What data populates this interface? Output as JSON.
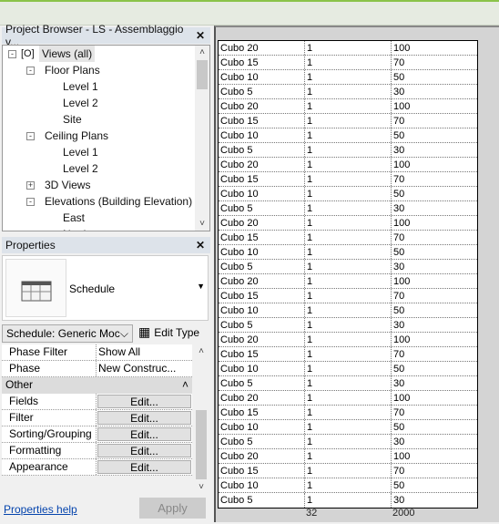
{
  "project_browser": {
    "title": "Project Browser - LS - Assemblaggio v...",
    "items": [
      {
        "label": "Views (all)",
        "level": 0,
        "toggle": "-"
      },
      {
        "label": "Floor Plans",
        "level": 1,
        "toggle": "-"
      },
      {
        "label": "Level 1",
        "level": 2
      },
      {
        "label": "Level 2",
        "level": 2
      },
      {
        "label": "Site",
        "level": 2
      },
      {
        "label": "Ceiling Plans",
        "level": 1,
        "toggle": "-"
      },
      {
        "label": "Level 1",
        "level": 2
      },
      {
        "label": "Level 2",
        "level": 2
      },
      {
        "label": "3D Views",
        "level": 1,
        "toggle": "+"
      },
      {
        "label": "Elevations (Building Elevation)",
        "level": 1,
        "toggle": "-"
      },
      {
        "label": "East",
        "level": 2
      },
      {
        "label": "North",
        "level": 2
      }
    ]
  },
  "properties": {
    "title": "Properties",
    "type_name": "Schedule",
    "selector": "Schedule: Generic Moc",
    "edit_type": "Edit Type",
    "rows": [
      {
        "key": "Phase Filter",
        "value": "Show All"
      },
      {
        "key": "Phase",
        "value": "New Construc..."
      }
    ],
    "group": "Other",
    "buttons": [
      {
        "key": "Fields",
        "value": "Edit..."
      },
      {
        "key": "Filter",
        "value": "Edit..."
      },
      {
        "key": "Sorting/Grouping",
        "value": "Edit..."
      },
      {
        "key": "Formatting",
        "value": "Edit..."
      },
      {
        "key": "Appearance",
        "value": "Edit..."
      }
    ],
    "help": "Properties help",
    "apply": "Apply"
  },
  "schedule": {
    "rows": [
      [
        "Cubo 20",
        "1",
        "100"
      ],
      [
        "Cubo 15",
        "1",
        "70"
      ],
      [
        "Cubo 10",
        "1",
        "50"
      ],
      [
        "Cubo 5",
        "1",
        "30"
      ],
      [
        "Cubo 20",
        "1",
        "100"
      ],
      [
        "Cubo 15",
        "1",
        "70"
      ],
      [
        "Cubo 10",
        "1",
        "50"
      ],
      [
        "Cubo 5",
        "1",
        "30"
      ],
      [
        "Cubo 20",
        "1",
        "100"
      ],
      [
        "Cubo 15",
        "1",
        "70"
      ],
      [
        "Cubo 10",
        "1",
        "50"
      ],
      [
        "Cubo 5",
        "1",
        "30"
      ],
      [
        "Cubo 20",
        "1",
        "100"
      ],
      [
        "Cubo 15",
        "1",
        "70"
      ],
      [
        "Cubo 10",
        "1",
        "50"
      ],
      [
        "Cubo 5",
        "1",
        "30"
      ],
      [
        "Cubo 20",
        "1",
        "100"
      ],
      [
        "Cubo 15",
        "1",
        "70"
      ],
      [
        "Cubo 10",
        "1",
        "50"
      ],
      [
        "Cubo 5",
        "1",
        "30"
      ],
      [
        "Cubo 20",
        "1",
        "100"
      ],
      [
        "Cubo 15",
        "1",
        "70"
      ],
      [
        "Cubo 10",
        "1",
        "50"
      ],
      [
        "Cubo 5",
        "1",
        "30"
      ],
      [
        "Cubo 20",
        "1",
        "100"
      ],
      [
        "Cubo 15",
        "1",
        "70"
      ],
      [
        "Cubo 10",
        "1",
        "50"
      ],
      [
        "Cubo 5",
        "1",
        "30"
      ],
      [
        "Cubo 20",
        "1",
        "100"
      ],
      [
        "Cubo 15",
        "1",
        "70"
      ],
      [
        "Cubo 10",
        "1",
        "50"
      ],
      [
        "Cubo 5",
        "1",
        "30"
      ]
    ],
    "totals": [
      "",
      "32",
      "2000"
    ]
  }
}
